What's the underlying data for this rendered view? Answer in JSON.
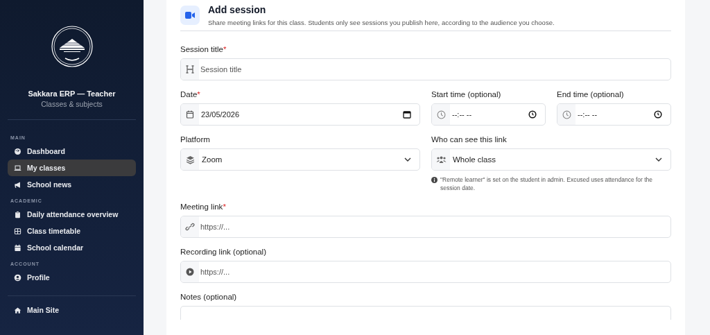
{
  "sidebar": {
    "brand_title": "Sakkara ERP — Teacher",
    "brand_subtitle": "Classes & subjects",
    "sections": [
      {
        "heading": "MAIN",
        "items": [
          {
            "label": "Dashboard",
            "selected": false
          },
          {
            "label": "My classes",
            "selected": true
          },
          {
            "label": "School news",
            "selected": false
          }
        ]
      },
      {
        "heading": "ACADEMIC",
        "items": [
          {
            "label": "Daily attendance overview",
            "selected": false
          },
          {
            "label": "Class timetable",
            "selected": false
          },
          {
            "label": "School calendar",
            "selected": false
          }
        ]
      },
      {
        "heading": "ACCOUNT",
        "items": [
          {
            "label": "Profile",
            "selected": false
          }
        ]
      }
    ],
    "footer_item": {
      "label": "Main Site"
    }
  },
  "form": {
    "title": "Add session",
    "description": "Share meeting links for this class. Students only see sessions you publish here, according to the audience you choose.",
    "rows": [
      [
        {
          "kind": "text",
          "label": "Session title",
          "required_mark": "*",
          "placeholder": "Session title"
        }
      ],
      [
        {
          "kind": "date",
          "label": "Date",
          "required_mark": "*",
          "value": "23/05/2026"
        },
        {
          "kind": "time",
          "label": "Start time (optional)",
          "placeholder": "--:-- --"
        },
        {
          "kind": "time",
          "label": "End time (optional)",
          "placeholder": "--:-- --"
        }
      ],
      [
        {
          "kind": "select",
          "label": "Platform",
          "value": "Zoom"
        },
        {
          "kind": "select",
          "label": "Who can see this link",
          "value": "Whole class",
          "hint": "\"Remote learner\" is set on the student in admin. Excused uses attendance for the session date."
        }
      ],
      [
        {
          "kind": "text",
          "label": "Meeting link",
          "required_mark": "*",
          "placeholder": "https://..."
        }
      ],
      [
        {
          "kind": "text",
          "label": "Recording link (optional)",
          "placeholder": "https://..."
        }
      ],
      [
        {
          "kind": "textarea",
          "label": "Notes (optional)"
        }
      ]
    ]
  }
}
